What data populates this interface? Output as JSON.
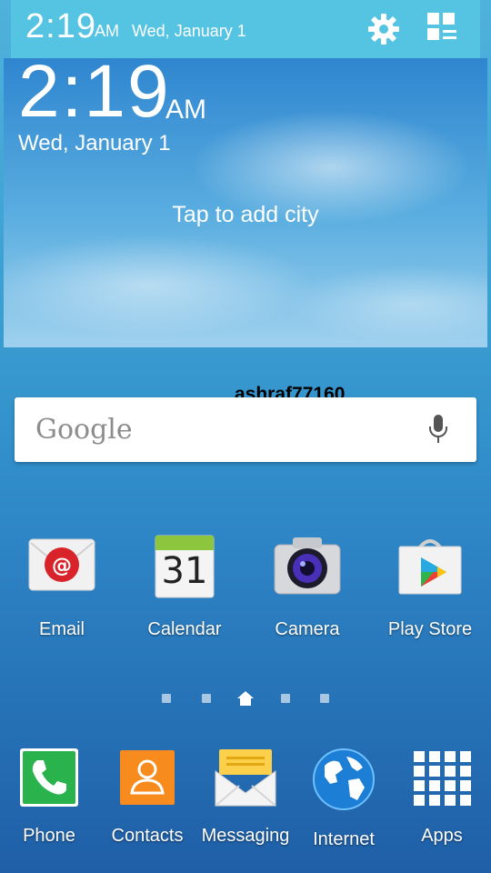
{
  "status_bar": {
    "time": "2:19",
    "ampm": "AM",
    "date": "Wed, January 1"
  },
  "weather_widget": {
    "time": "2:19",
    "ampm": "AM",
    "date": "Wed, January 1",
    "prompt": "Tap to add city"
  },
  "watermark": "ashraf77160",
  "search": {
    "logo": "Google"
  },
  "apps": {
    "email": "Email",
    "calendar": "Calendar",
    "calendar_day": "31",
    "camera": "Camera",
    "play_store": "Play Store"
  },
  "dock": {
    "phone": "Phone",
    "contacts": "Contacts",
    "messaging": "Messaging",
    "internet": "Internet",
    "apps": "Apps"
  },
  "page_indicator": {
    "pages": 5,
    "current": 3
  },
  "icons": [
    "settings-gear-icon",
    "quick-panel-grid-icon",
    "microphone-icon",
    "email-icon",
    "calendar-icon",
    "camera-icon",
    "play-store-icon",
    "phone-icon",
    "contacts-icon",
    "messaging-icon",
    "internet-globe-icon",
    "apps-grid-icon",
    "home-icon"
  ]
}
